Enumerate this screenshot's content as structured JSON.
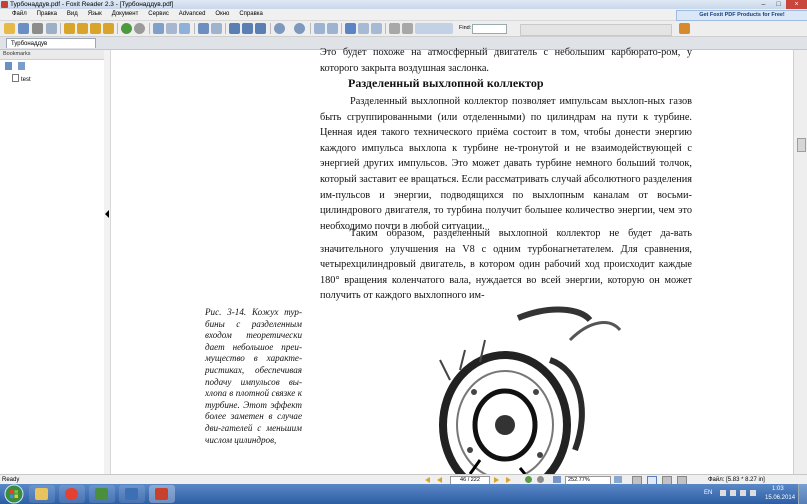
{
  "window": {
    "title": "Турбонаддув.pdf - Foxit Reader 2.3 - [Турбонаддув.pdf]"
  },
  "menu": [
    "Файл",
    "Правка",
    "Вид",
    "Язык",
    "Документ",
    "Сервис",
    "Advanced",
    "Окно",
    "Справка"
  ],
  "promo": "Get Foxit PDF Products for Free!",
  "toolbar": {
    "find_label": "Find:",
    "find_value": ""
  },
  "tab": {
    "label": "Турбонаддув"
  },
  "sidebar": {
    "title": "Bookmarks",
    "bookmarks": [
      "test"
    ]
  },
  "document": {
    "para_top": "Это будет похоже на атмосферный двигатель с небольшим карбюрато-ром, у которого закрыта воздушная заслонка.",
    "heading": "Разделенный выхлопной коллектор",
    "para_1": "Разделенный выхлопной коллектор позволяет импульсам выхлоп-ных газов быть сгруппированными (или отделенными) по цилиндрам на пути к турбине. Ценная идея такого технического приёма состоит в том, чтобы донести энергию каждого импульса выхлопа к турбине не-тронутой и не взаимодействующей с энергией других импульсов. Это может давать турбине немного больший толчок, который заставит ее вращаться. Если рассматривать случай абсолютного разделения им-пульсов и энергии, подводящихся по выхлопным каналам от восьми-цилиндрового двигателя, то турбина получит большее количество энергии, чем это необходимо почти в любой ситуации.",
    "para_2": "Таким образом, разделенный выхлопной коллектор не будет да-вать значительного улучшения на V8 с одним турбонагнетателем. Для сравнения, четырехцилиндровый двигатель, в котором один рабочий ход происходит каждые 180° вращения коленчатого вала, нуждается во всей энергии, которую он может получить от каждого выхлопного им-",
    "caption": "Рис. 3-14. Кожух тур-бины с разделенным входом теоретически дает небольшое преи-мущество в характе-ристиках, обеспечивая подачу импульсов вы-хлопа в плотной связке к турбине. Этот эффект более заметен в случае дви-гателей с меньшим числом цилиндров,"
  },
  "status": {
    "left": "Ready",
    "page": "46 / 222",
    "zoom": "252.77%",
    "size": "Файл: [5.83 * 8.27 in]"
  },
  "taskbar": {
    "lang": "EN",
    "time": "1:03",
    "date": "15.06.2014"
  }
}
